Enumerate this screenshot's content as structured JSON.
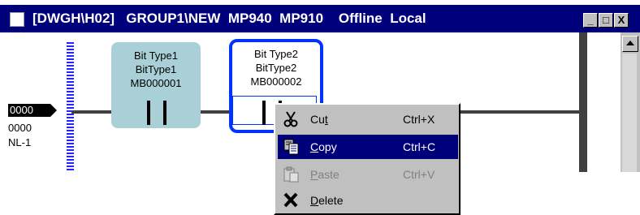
{
  "window": {
    "title": "[DWGH\\H02]   GROUP1\\NEW  MP940  MP910    Offline  Local",
    "buttons": {
      "minimize": "_",
      "maximize": "□",
      "close": "X"
    }
  },
  "register": {
    "value": "0000",
    "line2": "0000",
    "line3": "NL-1"
  },
  "cells": [
    {
      "lines": [
        "Bit Type1",
        "BitType1",
        "MB000001"
      ]
    },
    {
      "lines": [
        "Bit Type2",
        "BitType2",
        "MB000002"
      ]
    }
  ],
  "context_menu": {
    "items": [
      {
        "label": "Cut",
        "mnemonic_index": 2,
        "shortcut": "Ctrl+X",
        "icon": "scissors-icon",
        "state": "normal"
      },
      {
        "label": "Copy",
        "mnemonic_index": 0,
        "shortcut": "Ctrl+C",
        "icon": "copy-icon",
        "state": "highlighted"
      },
      {
        "label": "Paste",
        "mnemonic_index": 0,
        "shortcut": "Ctrl+V",
        "icon": "paste-icon",
        "state": "disabled"
      },
      {
        "label": "Delete",
        "mnemonic_index": 0,
        "shortcut": "",
        "icon": "delete-x-icon",
        "state": "normal"
      }
    ]
  },
  "colors": {
    "titlebar": "#00007b",
    "selection": "#0033ff",
    "cell_fill": "#a9d0d6",
    "menu_bg": "#c0c0c0",
    "menu_highlight": "#00007b"
  }
}
